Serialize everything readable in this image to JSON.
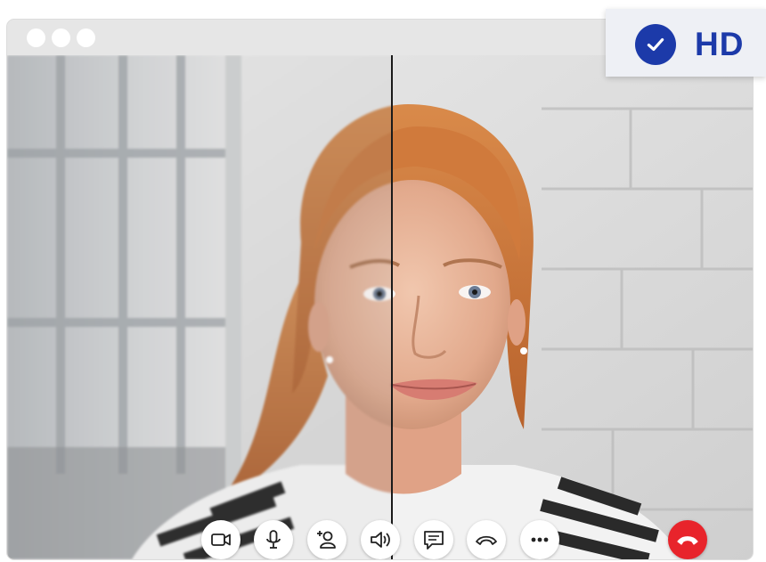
{
  "window": {
    "controls": [
      "close",
      "minimize",
      "maximize"
    ]
  },
  "video": {
    "comparison": [
      "blurred",
      "sharp"
    ],
    "colors": {
      "window_bar": "#e6e6e6",
      "end_call": "#e8242b",
      "hd_accent": "#1c3aa9",
      "divider": "#1a1a1a"
    }
  },
  "badge": {
    "icon": "checkmark-circle-icon",
    "label": "HD"
  },
  "controls": [
    {
      "id": "camera",
      "icon": "video-camera-icon"
    },
    {
      "id": "microphone",
      "icon": "microphone-icon"
    },
    {
      "id": "add-participant",
      "icon": "add-person-icon"
    },
    {
      "id": "speaker",
      "icon": "speaker-icon"
    },
    {
      "id": "chat",
      "icon": "chat-bubble-icon"
    },
    {
      "id": "hold",
      "icon": "hold-phone-icon"
    },
    {
      "id": "more",
      "icon": "more-dots-icon"
    },
    {
      "id": "end-call",
      "icon": "hang-up-icon"
    }
  ]
}
